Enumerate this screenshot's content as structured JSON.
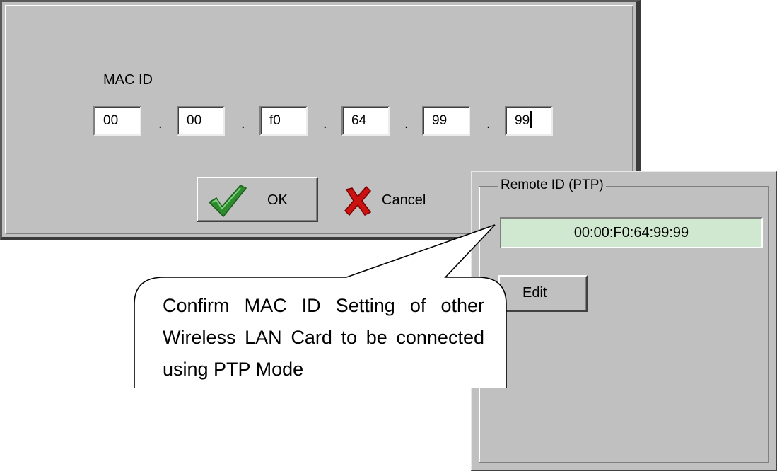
{
  "mac_dialog": {
    "label": "MAC ID",
    "octets": [
      "00",
      "00",
      "f0",
      "64",
      "99",
      "99"
    ],
    "separator": ".",
    "ok_label": "OK",
    "cancel_label": "Cancel"
  },
  "remote_panel": {
    "title": "Remote ID (PTP)",
    "value": "00:00:F0:64:99:99",
    "edit_label": "Edit"
  },
  "callout": {
    "text": "Confirm MAC ID Setting of other Wireless LAN Card to be connected using PTP Mode"
  },
  "icons": {
    "ok": "green-checkmark-icon",
    "cancel": "red-x-icon"
  },
  "colors": {
    "dialog_bg": "#c0c0c0",
    "remote_value_bg": "#cfe8cf",
    "check_green": "#2e8b2e",
    "cancel_red": "#cc1111"
  }
}
